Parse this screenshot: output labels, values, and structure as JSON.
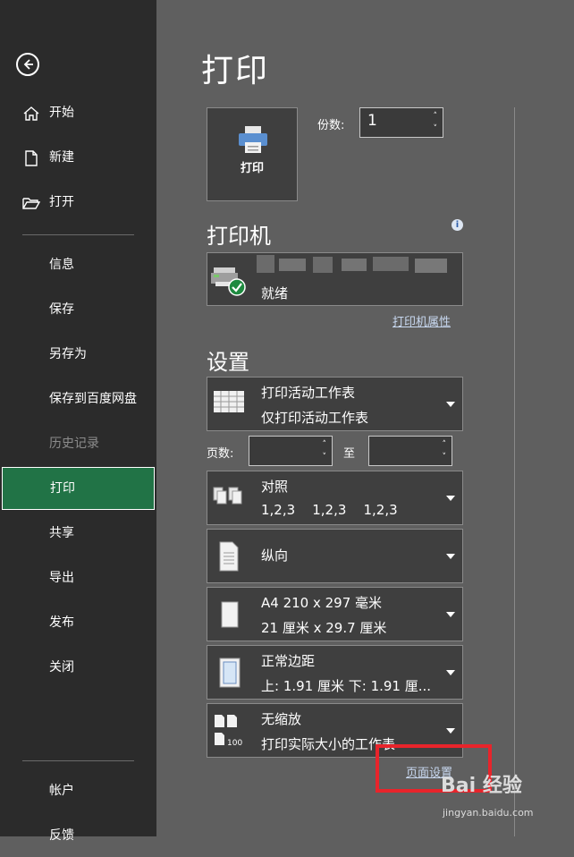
{
  "sidebar": {
    "items": [
      {
        "label": "开始"
      },
      {
        "label": "新建"
      },
      {
        "label": "打开"
      },
      {
        "label": "信息"
      },
      {
        "label": "保存"
      },
      {
        "label": "另存为"
      },
      {
        "label": "保存到百度网盘"
      },
      {
        "label": "历史记录"
      },
      {
        "label": "打印"
      },
      {
        "label": "共享"
      },
      {
        "label": "导出"
      },
      {
        "label": "发布"
      },
      {
        "label": "关闭"
      },
      {
        "label": "帐户"
      },
      {
        "label": "反馈"
      }
    ]
  },
  "main": {
    "title": "打印",
    "print_button": "打印",
    "copies_label": "份数:",
    "copies_value": "1",
    "printer_section": "打印机",
    "printer_status": "就绪",
    "printer_properties": "打印机属性",
    "settings_section": "设置",
    "pages_label": "页数:",
    "to_label": "至",
    "options": [
      {
        "line1": "打印活动工作表",
        "line2": "仅打印活动工作表"
      },
      {
        "line1": "对照",
        "line2": "1,2,3    1,2,3    1,2,3"
      },
      {
        "line1": "纵向",
        "line2": ""
      },
      {
        "line1": "A4 210 x 297 毫米",
        "line2": "21 厘米 x 29.7 厘米"
      },
      {
        "line1": "正常边距",
        "line2": "上: 1.91 厘米 下: 1.91 厘..."
      },
      {
        "line1": "无缩放",
        "line2": "打印实际大小的工作表"
      }
    ],
    "page_setup": "页面设置"
  },
  "watermark": {
    "brand": "Bai 经验",
    "url": "jingyan.baidu.com"
  },
  "colors": {
    "sidebar": "#2b2b2b",
    "main": "#5f5f5f",
    "active": "#217346",
    "highlight": "#e8242b"
  }
}
